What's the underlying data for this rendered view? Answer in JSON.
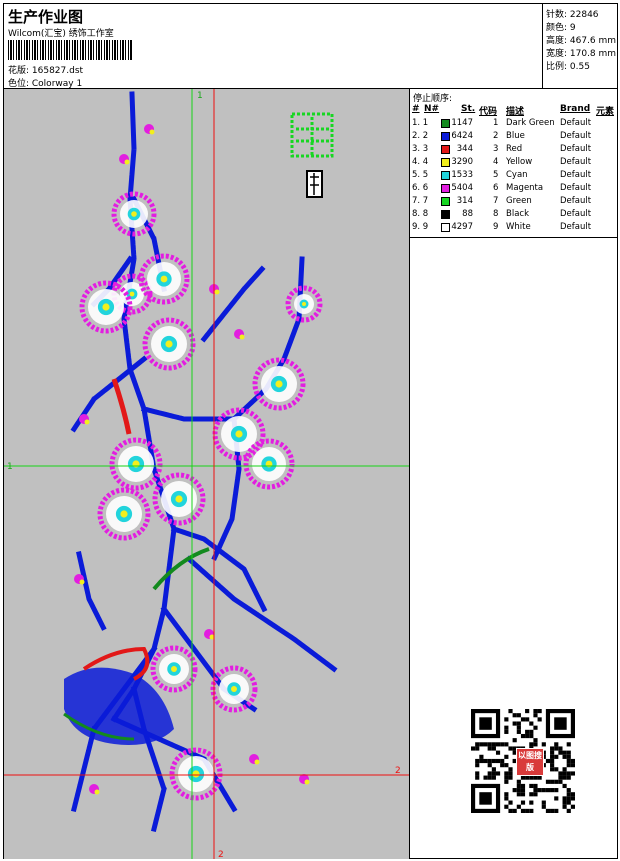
{
  "header": {
    "title": "生产作业图",
    "company": "Wilcom(汇宝) 绣饰工作室",
    "design": "花版:  165827.dst",
    "colorway": "色位:  Colorway 1"
  },
  "stats": {
    "stitches": "针数:  22846",
    "colors": "颜色:  9",
    "height": "高度:  467.6 mm",
    "width": "宽度:  170.8 mm",
    "scale": "比例:  0.55"
  },
  "stop_sequence": {
    "title": "停止顺序:",
    "headers": {
      "hash": "#",
      "no": "N#",
      "stitches": "St.",
      "code": "代码",
      "desc": "描述",
      "brand": "Brand",
      "element": "元素"
    },
    "rows": [
      {
        "idx": "1. 1",
        "color": "#138a1e",
        "st": "1147",
        "code": "1",
        "desc": "Dark Green",
        "brand": "Default"
      },
      {
        "idx": "2. 2",
        "color": "#0a1bd8",
        "st": "6424",
        "code": "2",
        "desc": "Blue",
        "brand": "Default"
      },
      {
        "idx": "3. 3",
        "color": "#e21818",
        "st": "344",
        "code": "3",
        "desc": "Red",
        "brand": "Default"
      },
      {
        "idx": "4. 4",
        "color": "#f2ef1c",
        "st": "3290",
        "code": "4",
        "desc": "Yellow",
        "brand": "Default"
      },
      {
        "idx": "5. 5",
        "color": "#22d4dc",
        "st": "1533",
        "code": "5",
        "desc": "Cyan",
        "brand": "Default"
      },
      {
        "idx": "6. 6",
        "color": "#e21ee0",
        "st": "5404",
        "code": "6",
        "desc": "Magenta",
        "brand": "Default"
      },
      {
        "idx": "7. 7",
        "color": "#17d622",
        "st": "314",
        "code": "7",
        "desc": "Green",
        "brand": "Default"
      },
      {
        "idx": "8. 8",
        "color": "#000000",
        "st": "88",
        "code": "8",
        "desc": "Black",
        "brand": "Default"
      },
      {
        "idx": "9. 9",
        "color": "#ffffff",
        "st": "4297",
        "code": "9",
        "desc": "White",
        "brand": "Default"
      }
    ]
  },
  "guides": {
    "v1": "1",
    "h1": "1",
    "v2": "2",
    "h2": "2"
  },
  "qr_seal": "以图搜版"
}
